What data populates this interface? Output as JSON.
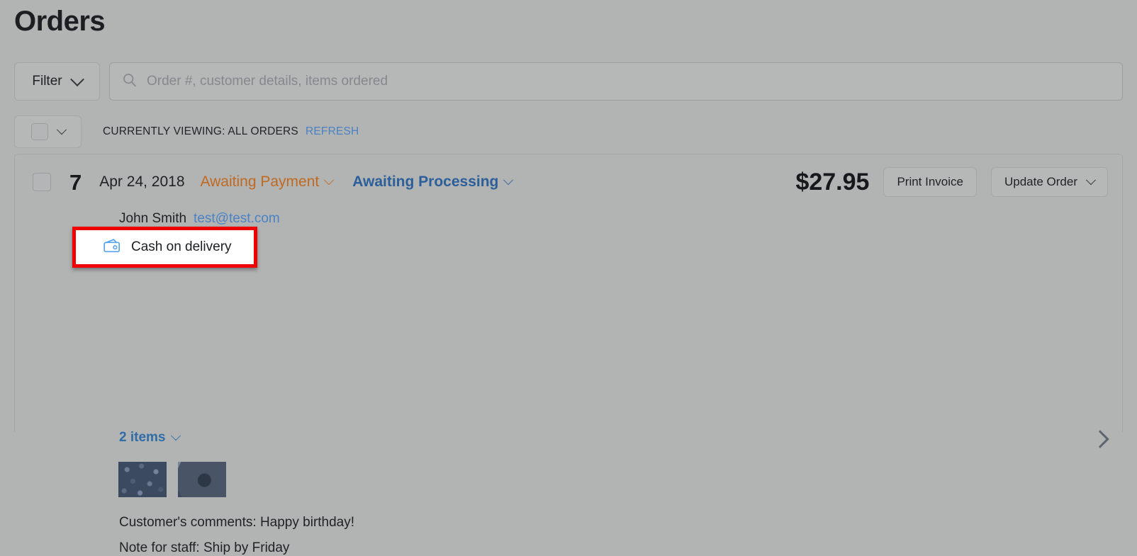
{
  "page": {
    "title": "Orders",
    "background_color": "#b2b3b3"
  },
  "toolbar": {
    "filter_label": "Filter",
    "filter_chevron_icon": "chevron-down-icon",
    "search_icon": "search-icon",
    "search_placeholder": "Order #, customer details, items ordered",
    "search_value": ""
  },
  "viewing_bar": {
    "bulk_checkbox_icon": "checkbox-unchecked-icon",
    "bulk_chevron_icon": "chevron-down-icon",
    "viewing_text": "CURRENTLY VIEWING: ALL ORDERS",
    "refresh_label": "REFRESH",
    "refresh_color": "#4a82c4"
  },
  "order": {
    "row_checkbox_icon": "checkbox-unchecked-icon",
    "number": "7",
    "date": "Apr 24, 2018",
    "payment_status": "Awaiting Payment",
    "payment_status_color": "#c06a21",
    "payment_status_chevron_icon": "chevron-down-icon",
    "processing_status": "Awaiting Processing",
    "processing_status_color": "#2c5f99",
    "processing_status_chevron_icon": "chevron-down-icon",
    "total": "$27.95",
    "print_invoice_label": "Print Invoice",
    "update_order_label": "Update Order",
    "update_order_chevron_icon": "chevron-down-icon",
    "customer_name": "John Smith",
    "customer_email": "test@test.com",
    "customer_email_color": "#4a82c4",
    "payment_method": {
      "icon": "wallet-icon",
      "label": "Cash on delivery",
      "highlight_border_color": "#f00000",
      "highlight_background": "#ffffff"
    },
    "items_toggle_label": "2 items",
    "items_toggle_chevron_icon": "chevron-down-icon",
    "thumbnails": [
      {
        "name": "product-thumbnail-1"
      },
      {
        "name": "product-thumbnail-2"
      }
    ],
    "customer_comments": "Customer's comments: Happy birthday!",
    "staff_note": "Note for staff: Ship by Friday",
    "expand_chevron_icon": "chevron-right-icon"
  }
}
